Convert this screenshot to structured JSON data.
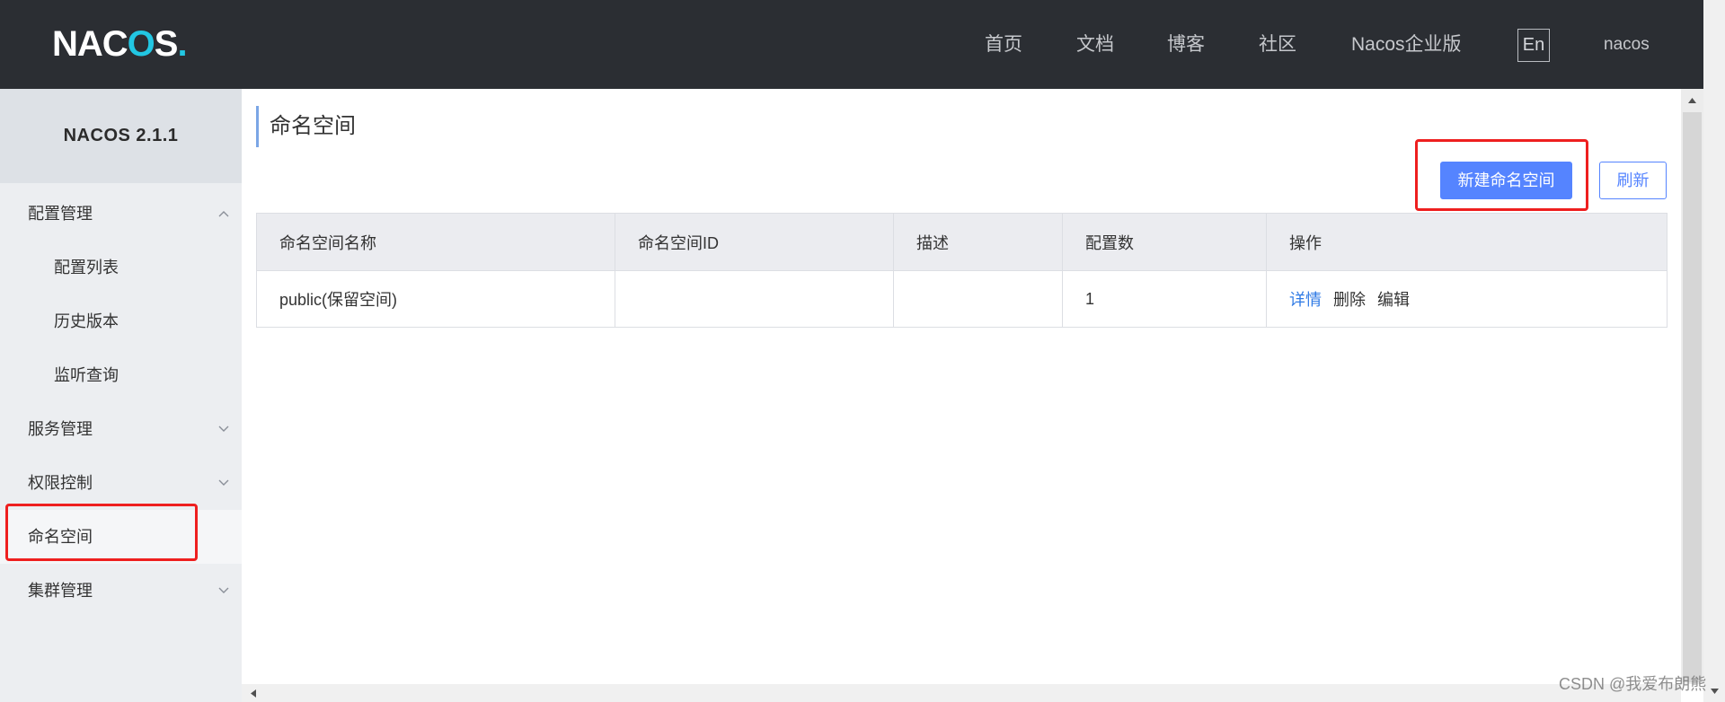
{
  "logo": {
    "parts": [
      "NA",
      "C",
      "O",
      "S",
      "."
    ]
  },
  "header": {
    "nav": [
      {
        "label": "首页"
      },
      {
        "label": "文档"
      },
      {
        "label": "博客"
      },
      {
        "label": "社区"
      },
      {
        "label": "Nacos企业版"
      }
    ],
    "language_toggle": "En",
    "username": "nacos"
  },
  "sidebar": {
    "version": "NACOS 2.1.1",
    "menu": [
      {
        "label": "配置管理",
        "level": 1,
        "icon": "chevron-up-icon",
        "expanded": true
      },
      {
        "label": "配置列表",
        "level": 2
      },
      {
        "label": "历史版本",
        "level": 2
      },
      {
        "label": "监听查询",
        "level": 2
      },
      {
        "label": "服务管理",
        "level": 1,
        "icon": "chevron-down-icon",
        "expanded": false
      },
      {
        "label": "权限控制",
        "level": 1,
        "icon": "chevron-down-icon",
        "expanded": false
      },
      {
        "label": "命名空间",
        "level": 1,
        "selected": true
      },
      {
        "label": "集群管理",
        "level": 1,
        "icon": "chevron-down-icon",
        "expanded": false
      }
    ]
  },
  "page": {
    "title": "命名空间"
  },
  "toolbar": {
    "create_label": "新建命名空间",
    "refresh_label": "刷新"
  },
  "table": {
    "columns": [
      "命名空间名称",
      "命名空间ID",
      "描述",
      "配置数",
      "操作"
    ],
    "rows": [
      {
        "name": "public(保留空间)",
        "id": "",
        "description": "",
        "config_count": "1",
        "actions": [
          "详情",
          "删除",
          "编辑"
        ]
      }
    ]
  },
  "watermark": "CSDN @我爱布朗熊",
  "colors": {
    "header_bg": "#2b2e33",
    "accent": "#5584ff",
    "link": "#2f7ae5",
    "logo_cyan": "#22c7e3",
    "annotation_red": "#ee1f1f"
  }
}
